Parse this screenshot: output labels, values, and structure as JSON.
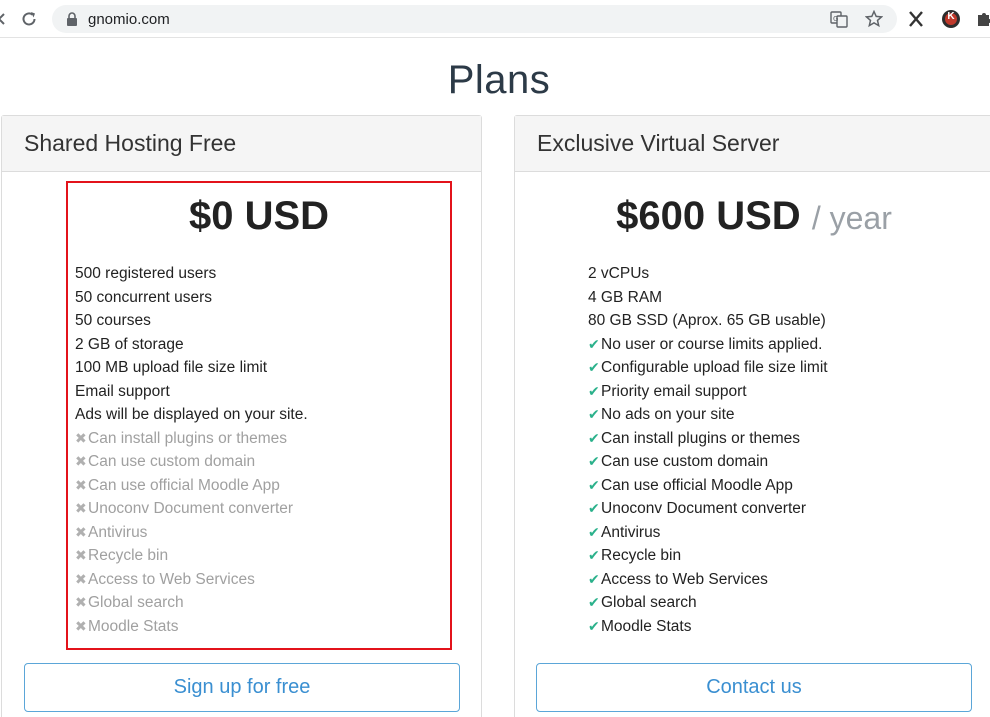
{
  "browser": {
    "url": "gnomio.com",
    "profile_initial": "K"
  },
  "page": {
    "title": "Plans"
  },
  "plans": [
    {
      "name": "Shared Hosting Free",
      "price": "$0 USD",
      "period": "",
      "features": [
        {
          "text": "500 registered users",
          "state": "plain"
        },
        {
          "text": "50 concurrent users",
          "state": "plain"
        },
        {
          "text": "50 courses",
          "state": "plain"
        },
        {
          "text": "2 GB of storage",
          "state": "plain"
        },
        {
          "text": "100 MB upload file size limit",
          "state": "plain"
        },
        {
          "text": "Email support",
          "state": "plain"
        },
        {
          "text": "Ads will be displayed on your site.",
          "state": "plain"
        },
        {
          "text": "Can install plugins or themes",
          "state": "no"
        },
        {
          "text": "Can use custom domain",
          "state": "no"
        },
        {
          "text": "Can use official Moodle App",
          "state": "no"
        },
        {
          "text": "Unoconv Document converter",
          "state": "no"
        },
        {
          "text": "Antivirus",
          "state": "no"
        },
        {
          "text": "Recycle bin",
          "state": "no"
        },
        {
          "text": "Access to Web Services",
          "state": "no"
        },
        {
          "text": "Global search",
          "state": "no"
        },
        {
          "text": "Moodle Stats",
          "state": "no"
        }
      ],
      "cta": "Sign up for free"
    },
    {
      "name": "Exclusive Virtual Server",
      "price": "$600 USD",
      "period": "/ year",
      "features": [
        {
          "text": "2 vCPUs",
          "state": "plain"
        },
        {
          "text": "4 GB RAM",
          "state": "plain"
        },
        {
          "text": "80 GB SSD (Aprox. 65 GB usable)",
          "state": "plain"
        },
        {
          "text": "No user or course limits applied.",
          "state": "yes"
        },
        {
          "text": "Configurable upload file size limit",
          "state": "yes"
        },
        {
          "text": "Priority email support",
          "state": "yes"
        },
        {
          "text": "No ads on your site",
          "state": "yes"
        },
        {
          "text": "Can install plugins or themes",
          "state": "yes"
        },
        {
          "text": "Can use custom domain",
          "state": "yes"
        },
        {
          "text": "Can use official Moodle App",
          "state": "yes"
        },
        {
          "text": "Unoconv Document converter",
          "state": "yes"
        },
        {
          "text": "Antivirus",
          "state": "yes"
        },
        {
          "text": "Recycle bin",
          "state": "yes"
        },
        {
          "text": "Access to Web Services",
          "state": "yes"
        },
        {
          "text": "Global search",
          "state": "yes"
        },
        {
          "text": "Moodle Stats",
          "state": "yes"
        }
      ],
      "cta": "Contact us"
    }
  ],
  "colors": {
    "check": "#2bb18b",
    "cross": "#b0b0b0",
    "highlight": "#e3131b",
    "button_text": "#3a8fd1"
  }
}
